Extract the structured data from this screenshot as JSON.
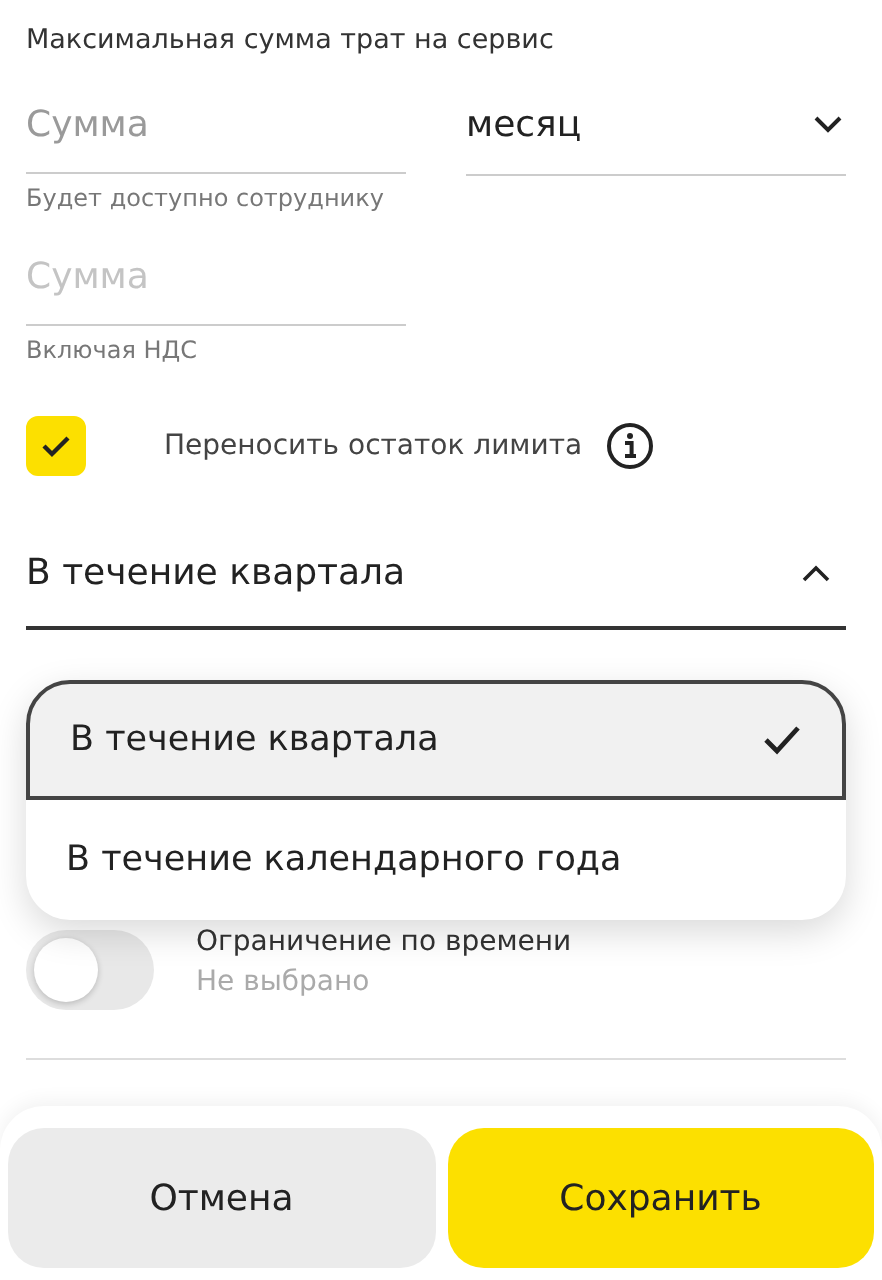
{
  "title": "Максимальная сумма трат на сервис",
  "amount_field": {
    "placeholder": "Сумма",
    "helper": "Будет доступно сотруднику"
  },
  "period_select": {
    "value": "месяц",
    "expanded": false
  },
  "vat_field": {
    "placeholder": "Сумма",
    "helper": "Включая НДС"
  },
  "carryover": {
    "label": "Переносить остаток лимита",
    "checked": true
  },
  "carryover_period": {
    "value": "В течение квартала",
    "expanded": true
  },
  "dropdown_options": [
    {
      "label": "В течение квартала",
      "selected": true
    },
    {
      "label": "В течение календарного года",
      "selected": false
    }
  ],
  "time_limit": {
    "label": "Ограничение по времени",
    "value": "Не выбрано",
    "on": false
  },
  "buttons": [
    {
      "label": "Отмена",
      "kind": "secondary"
    },
    {
      "label": "Сохранить",
      "kind": "primary"
    }
  ]
}
